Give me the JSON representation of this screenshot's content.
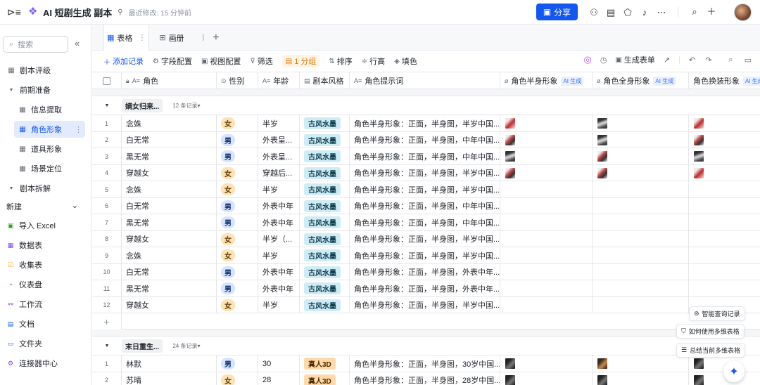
{
  "topbar": {
    "title": "AI 短剧生成 副本",
    "saved": "最近修改: 15 分钟前",
    "share_label": "分享"
  },
  "sidebar": {
    "search_placeholder": "搜索",
    "items": [
      {
        "label": "剧本评级",
        "icon": "grid-icon"
      },
      {
        "label": "前期准备",
        "icon": "caret-down-icon"
      },
      {
        "label": "信息提取",
        "icon": "grid-icon"
      },
      {
        "label": "角色形象",
        "icon": "grid-icon"
      },
      {
        "label": "道具形象",
        "icon": "grid-icon"
      },
      {
        "label": "场景定位",
        "icon": "grid-icon"
      },
      {
        "label": "剧本拆解",
        "icon": "caret-down-icon"
      }
    ],
    "new_label": "新建",
    "tools": [
      {
        "label": "导入 Excel",
        "color": "#2ea121"
      },
      {
        "label": "数据表",
        "color": "#7f3bf5"
      },
      {
        "label": "收集表",
        "color": "#f5a623"
      },
      {
        "label": "仪表盘",
        "color": "#1456f0"
      },
      {
        "label": "工作流",
        "color": "#7f3bf5"
      },
      {
        "label": "文档",
        "color": "#1456f0"
      },
      {
        "label": "文件夹",
        "color": "#1456f0"
      },
      {
        "label": "连接器中心",
        "color": "#7f3bf5"
      }
    ]
  },
  "tabs": [
    {
      "label": "表格"
    },
    {
      "label": "画册"
    }
  ],
  "toolbar": {
    "add_record": "添加记录",
    "field_config": "字段配置",
    "view_config": "视图配置",
    "filter": "筛选",
    "group": "1 分组",
    "sort": "排序",
    "row_height": "行高",
    "fill": "填色",
    "gen_form": "生成表单"
  },
  "columns": [
    "角色",
    "性别",
    "年龄",
    "剧本风格",
    "角色提示词",
    "角色半身形象",
    "角色全身形象",
    "角色换装形象"
  ],
  "ai_tag": "AI 生成",
  "groups": [
    {
      "name": "嫡女归来...",
      "count": "12 条记录",
      "rows": [
        {
          "n": "1",
          "role": "念姝",
          "gender": "女",
          "age": "半岁",
          "style": "古风水墨",
          "prompt": "角色半身形象：正面，半身图，半岁中国...",
          "imgs": [
            "t3",
            "t2",
            "t3"
          ]
        },
        {
          "n": "2",
          "role": "白无常",
          "gender": "男",
          "age": "外表呈...",
          "style": "古风水墨",
          "prompt": "角色半身形象：正面，半身图，中年中国...",
          "imgs": [
            "t1",
            "t2",
            "t1"
          ]
        },
        {
          "n": "3",
          "role": "黑无常",
          "gender": "男",
          "age": "外表呈...",
          "style": "古风水墨",
          "prompt": "角色半身形象：正面，半身图，中年中国...",
          "imgs": [
            "t2",
            "t1",
            "t2"
          ]
        },
        {
          "n": "4",
          "role": "穿越女",
          "gender": "女",
          "age": "穿越后...",
          "style": "古风水墨",
          "prompt": "角色半身形象：正面，半身图，半岁中国...",
          "imgs": [
            "t1",
            "t1",
            "t3"
          ]
        },
        {
          "n": "5",
          "role": "念姝",
          "gender": "女",
          "age": "半岁",
          "style": "古风水墨",
          "prompt": "角色半身形象：正面，半身图，半岁中国...",
          "imgs": []
        },
        {
          "n": "6",
          "role": "白无常",
          "gender": "男",
          "age": "外表中年",
          "style": "古风水墨",
          "prompt": "角色半身形象：正面，半身图，中年中国...",
          "imgs": []
        },
        {
          "n": "7",
          "role": "黑无常",
          "gender": "男",
          "age": "外表中年",
          "style": "古风水墨",
          "prompt": "角色半身形象：正面，半身图，中年中国...",
          "imgs": []
        },
        {
          "n": "8",
          "role": "穿越女",
          "gender": "女",
          "age": "半岁（...",
          "style": "古风水墨",
          "prompt": "角色半身形象：正面，半身图，半岁中国...",
          "imgs": []
        },
        {
          "n": "9",
          "role": "念姝",
          "gender": "女",
          "age": "半岁",
          "style": "古风水墨",
          "prompt": "角色半身形象：正面，半身图，半岁中国...",
          "imgs": []
        },
        {
          "n": "10",
          "role": "白无常",
          "gender": "男",
          "age": "外表中年",
          "style": "古风水墨",
          "prompt": "角色半身形象：正面，半身图，外表中年...",
          "imgs": []
        },
        {
          "n": "11",
          "role": "黑无常",
          "gender": "男",
          "age": "外表中年",
          "style": "古风水墨",
          "prompt": "角色半身形象：正面，半身图，外表中年...",
          "imgs": []
        },
        {
          "n": "12",
          "role": "穿越女",
          "gender": "女",
          "age": "半岁",
          "style": "古风水墨",
          "prompt": "角色半身形象：正面，半身图，半岁中国...",
          "imgs": []
        }
      ]
    },
    {
      "name": "末日重生...",
      "count": "24 条记录",
      "rows": [
        {
          "n": "1",
          "role": "林默",
          "gender": "男",
          "age": "30",
          "style": "真人3D",
          "prompt": "角色半身形象：正面，半身图，30岁中国...",
          "imgs": [
            "t5",
            "t4",
            "t5"
          ]
        },
        {
          "n": "2",
          "role": "苏晴",
          "gender": "女",
          "age": "28",
          "style": "真人3D",
          "prompt": "角色半身形象：正面，半身图，28岁中国...",
          "imgs": [
            "t5",
            "t5",
            "t5"
          ]
        }
      ]
    }
  ],
  "float_buttons": [
    "智能查询记录",
    "如何使用多维表格",
    "总结当前多维表格"
  ]
}
